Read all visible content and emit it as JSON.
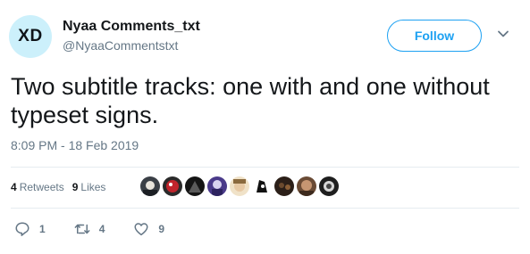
{
  "user": {
    "avatar_text": "XD",
    "name": "Nyaa Comments_txt",
    "handle": "@NyaaCommentstxt"
  },
  "follow_label": "Follow",
  "tweet": {
    "text": "Two subtitle tracks: one with and one without typeset signs.",
    "timestamp": "8:09 PM - 18 Feb 2019"
  },
  "stats": {
    "retweets_count": "4",
    "retweets_label": "Retweets",
    "likes_count": "9",
    "likes_label": "Likes"
  },
  "likers_count": 9,
  "actions": {
    "reply_count": "1",
    "retweet_count": "4",
    "like_count": "9"
  },
  "colors": {
    "accent": "#1da1f2",
    "text": "#14171a",
    "muted": "#657786",
    "divider": "#e6ecf0",
    "avatar_bg": "#ccf0fb"
  }
}
